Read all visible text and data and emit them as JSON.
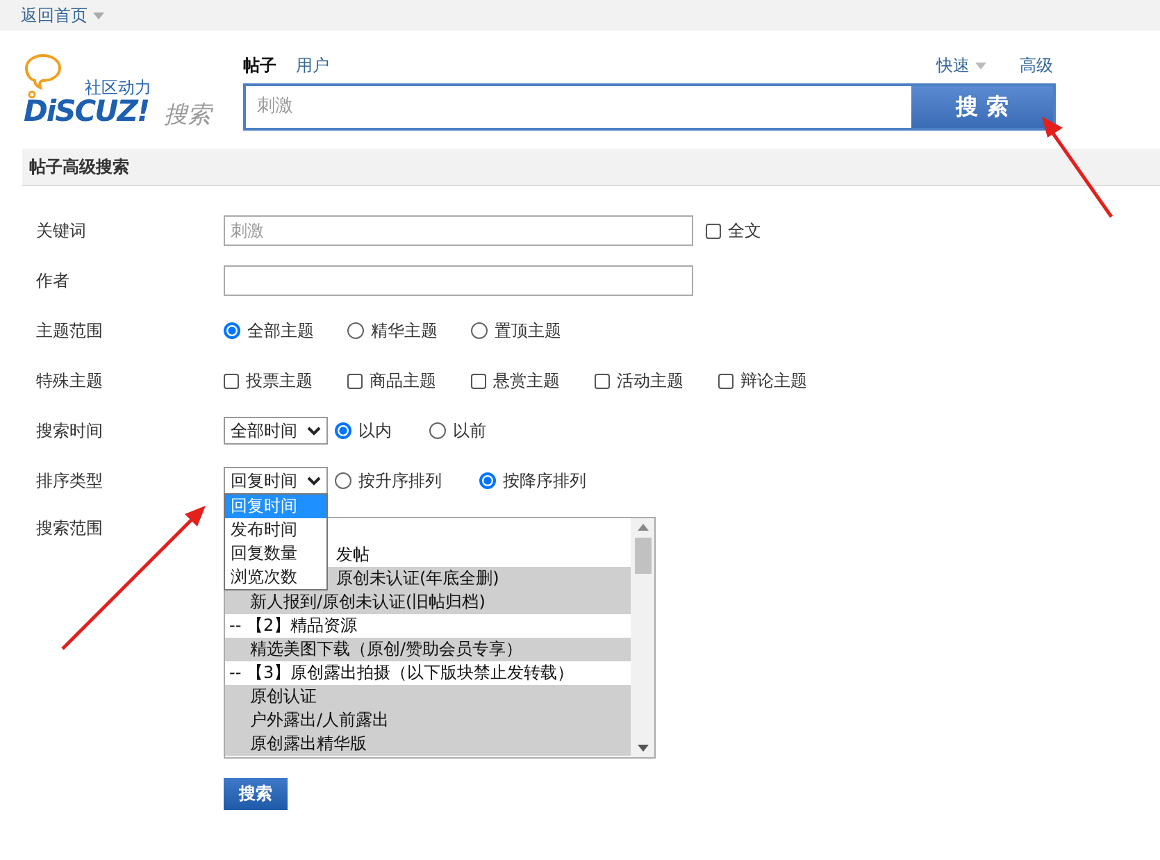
{
  "top_bar": {
    "link": "返回首页"
  },
  "logo": {
    "tagline": "社区动力",
    "wordmark": "DiSCUZ!",
    "subtitle": "搜索"
  },
  "search": {
    "tabs": [
      {
        "label": "帖子",
        "selected": true
      },
      {
        "label": "用户",
        "selected": false
      }
    ],
    "quick": "快速",
    "advanced": "高级",
    "value": "刺激",
    "button": "搜 索"
  },
  "form": {
    "title": "帖子高级搜索",
    "rows": [
      {
        "kind": "text",
        "label": "关键词",
        "value": "刺激",
        "checkbox": {
          "label": "全文",
          "checked": false
        }
      },
      {
        "kind": "text",
        "label": "作者"
      },
      {
        "kind": "radios",
        "label": "主题范围",
        "options": [
          {
            "label": "全部主题",
            "selected": true
          },
          {
            "label": "精华主题",
            "selected": false
          },
          {
            "label": "置顶主题",
            "selected": false
          }
        ]
      },
      {
        "kind": "checkboxes",
        "label": "特殊主题",
        "options": [
          {
            "label": "投票主题",
            "checked": false
          },
          {
            "label": "商品主题",
            "checked": false
          },
          {
            "label": "悬赏主题",
            "checked": false
          },
          {
            "label": "活动主题",
            "checked": false
          },
          {
            "label": "辩论主题",
            "checked": false
          }
        ]
      },
      {
        "kind": "select",
        "label": "搜索时间",
        "select": {
          "value": "全部时间"
        },
        "options": [
          {
            "label": "以内",
            "selected": true
          },
          {
            "label": "以前",
            "selected": false
          }
        ]
      },
      {
        "kind": "select",
        "label": "排序类型",
        "select": {
          "value": "回复时间",
          "menu": [
            {
              "label": "回复时间",
              "selected": true
            },
            {
              "label": "发布时间",
              "selected": false
            },
            {
              "label": "回复数量",
              "selected": false
            },
            {
              "label": "浏览次数",
              "selected": false
            }
          ]
        },
        "options": [
          {
            "label": "按升序排列",
            "selected": false
          },
          {
            "label": "按降序排列",
            "selected": true
          }
        ]
      },
      {
        "kind": "list",
        "label": "搜索范围",
        "items": [
          {
            "kind": "group",
            "label": "发帖",
            "selected": false
          },
          {
            "kind": "forum",
            "label": "原创未认证(年底全删)",
            "selected": true
          },
          {
            "kind": "forum",
            "label": "新人报到/原创未认证(旧帖归档)",
            "selected": true
          },
          {
            "kind": "group",
            "label": "-- 【2】精品资源",
            "selected": false
          },
          {
            "kind": "forum",
            "label": "精选美图下载（原创/赞助会员专享）",
            "selected": true
          },
          {
            "kind": "group",
            "label": "-- 【3】原创露出拍摄（以下版块禁止发转载）",
            "selected": false
          },
          {
            "kind": "forum",
            "label": "原创认证",
            "selected": true
          },
          {
            "kind": "forum",
            "label": "户外露出/人前露出",
            "selected": true
          },
          {
            "kind": "forum",
            "label": "原创露出精华版",
            "selected": true
          }
        ]
      }
    ],
    "submit": "搜索"
  }
}
